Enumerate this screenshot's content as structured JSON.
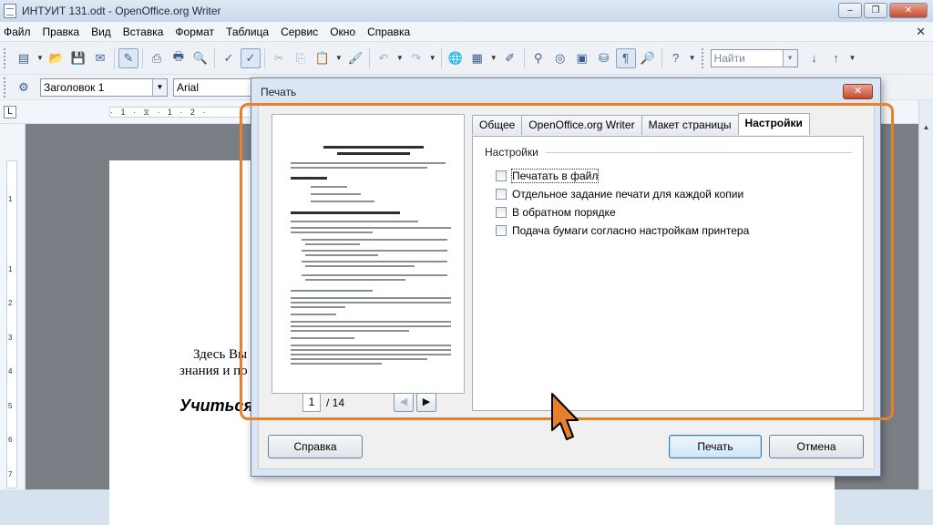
{
  "window": {
    "title": "ИНТУИТ 131.odt - OpenOffice.org Writer",
    "controls": [
      "–",
      "❐",
      "✕"
    ]
  },
  "menu": [
    "Файл",
    "Правка",
    "Вид",
    "Вставка",
    "Формат",
    "Таблица",
    "Сервис",
    "Окно",
    "Справка"
  ],
  "toolbar": {
    "find_placeholder": "Найти"
  },
  "formatting": {
    "style": "Заголовок 1",
    "font": "Arial"
  },
  "ruler": {
    "h_text": "· 1 · ⧖ · 1 · 2 ·",
    "v_numbers": [
      "1",
      "1",
      "2",
      "3",
      "4",
      "5",
      "6",
      "7"
    ]
  },
  "document": {
    "line1": "Здесь Вы",
    "line2": "знания и по",
    "heading": "Учиться"
  },
  "dialog": {
    "title": "Печать",
    "close": "✕",
    "page_number": "1",
    "page_total": "/ 14",
    "tabs": [
      "Общее",
      "OpenOffice.org Writer",
      "Макет страницы",
      "Настройки"
    ],
    "active_tab": "Настройки",
    "group_title": "Настройки",
    "options": [
      {
        "label": "Печатать в файл",
        "checked": false
      },
      {
        "label": "Отдельное задание печати для каждой копии",
        "checked": false
      },
      {
        "label": "В обратном порядке",
        "checked": false
      },
      {
        "label": "Подача бумаги согласно настройкам принтера",
        "checked": false
      }
    ],
    "buttons": {
      "help": "Справка",
      "print": "Печать",
      "cancel": "Отмена"
    }
  },
  "colors": {
    "highlight": "#e87f2b",
    "cursor": "#e87f2b"
  }
}
